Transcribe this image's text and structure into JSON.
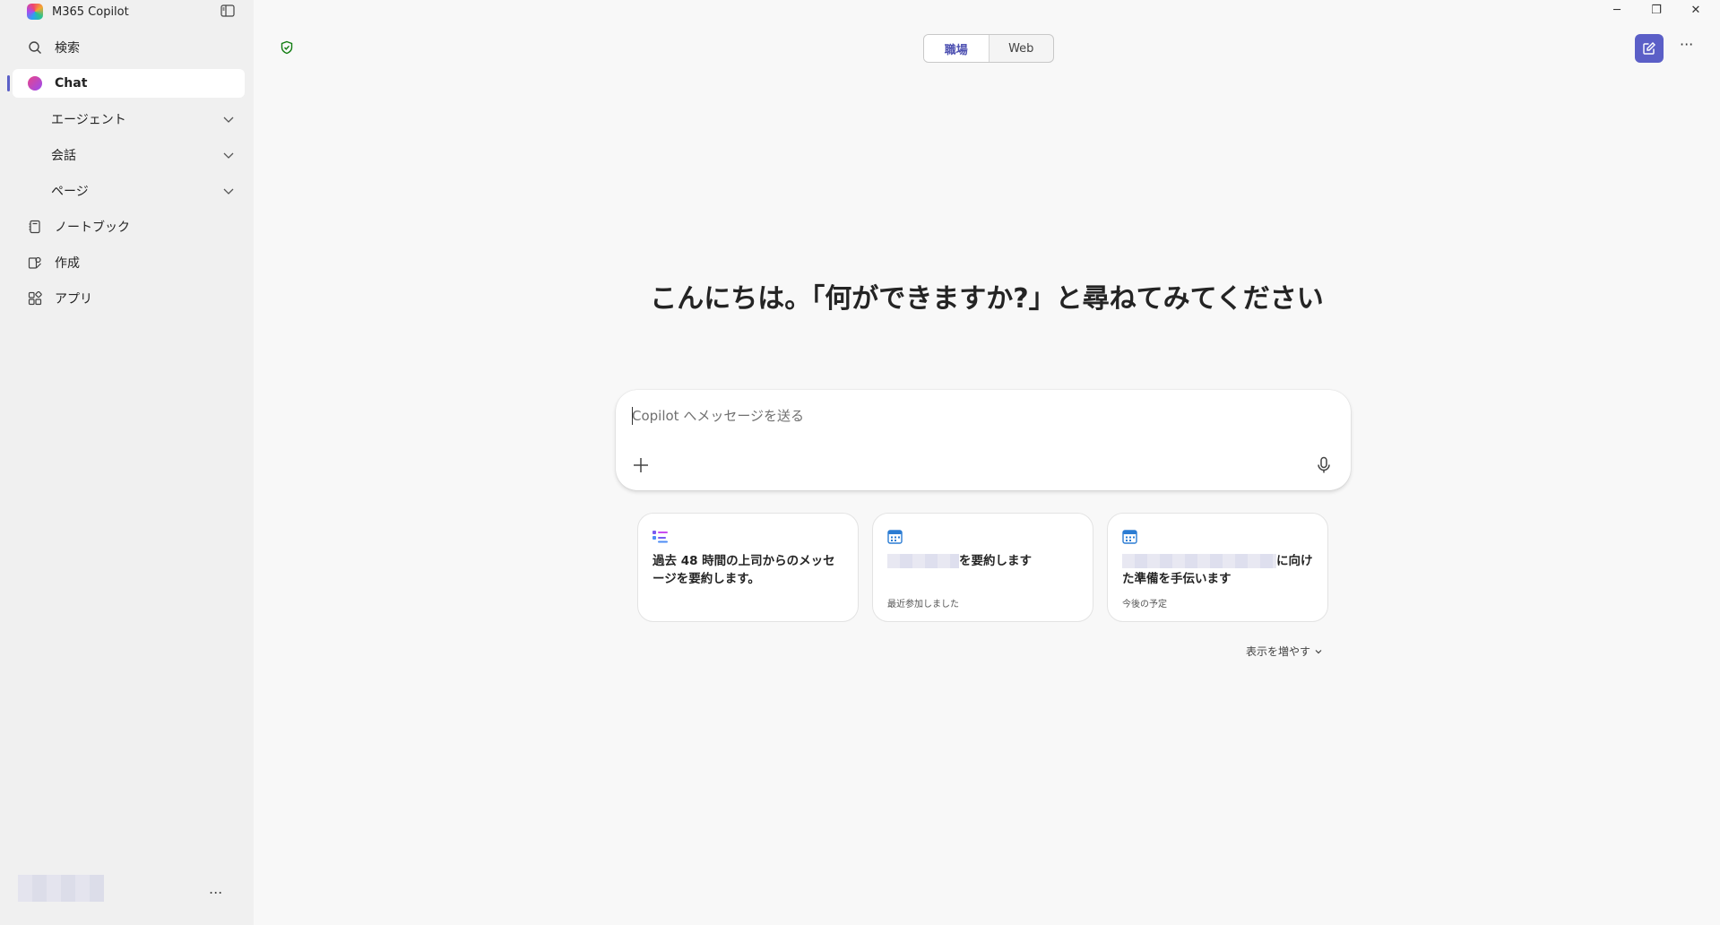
{
  "window": {
    "title": "M365 Copilot",
    "controls": {
      "minimize": "─",
      "restore": "❐",
      "close": "✕"
    }
  },
  "sidebar": {
    "items": [
      {
        "label": "検索",
        "icon": "search-icon"
      },
      {
        "label": "Chat",
        "icon": "copilot-chat-icon",
        "active": true
      },
      {
        "label": "エージェント",
        "icon": "chevron-down-icon"
      },
      {
        "label": "会話",
        "icon": "chevron-down-icon"
      },
      {
        "label": "ページ",
        "icon": "chevron-down-icon"
      },
      {
        "label": "ノートブック",
        "icon": "notebook-icon"
      },
      {
        "label": "作成",
        "icon": "create-icon"
      },
      {
        "label": "アプリ",
        "icon": "apps-icon"
      }
    ],
    "footer": {
      "more": "..."
    }
  },
  "header": {
    "tabs": [
      {
        "label": "職場",
        "selected": true
      },
      {
        "label": "Web",
        "selected": false
      }
    ],
    "more": "···"
  },
  "main": {
    "greeting": "こんにちは。「何ができますか?」と尋ねてみてください",
    "composer": {
      "placeholder": "Copilot へメッセージを送る"
    },
    "cards": [
      {
        "title": "過去 48 時間の上司からのメッセージを要約します。",
        "subtitle": ""
      },
      {
        "title": "を要約します",
        "subtitle": "最近参加しました"
      },
      {
        "title": "に向けた準備を手伝います",
        "subtitle": "今後の予定"
      }
    ],
    "show_more": "表示を増やす"
  },
  "colors": {
    "accent": "#5b5fc7",
    "sidebar_bg": "#f0f0f0",
    "main_bg": "#f8f8f8"
  }
}
